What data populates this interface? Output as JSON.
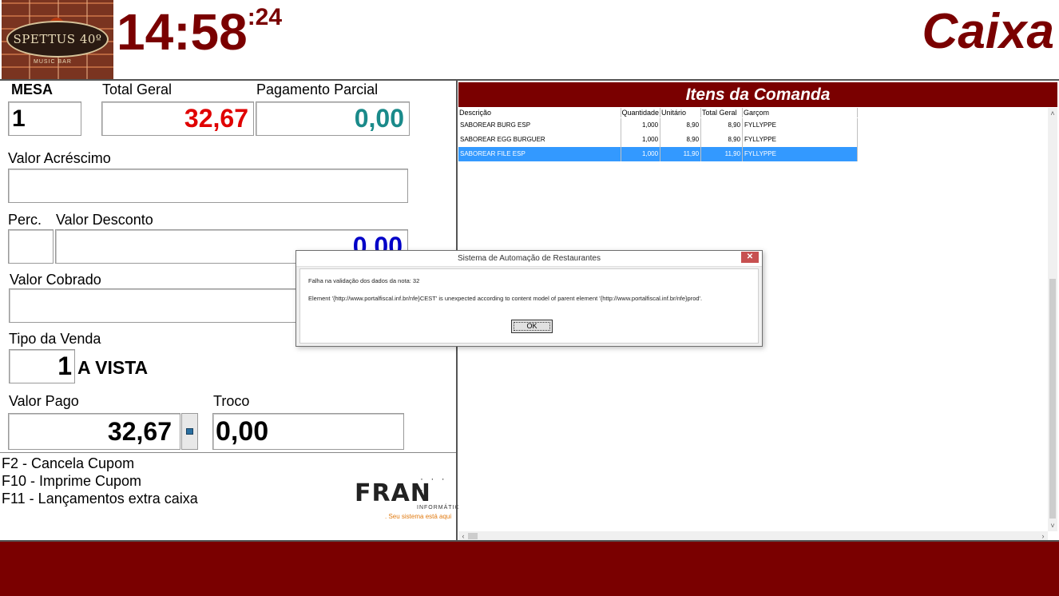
{
  "header": {
    "logo_text": "SPETTUS 40º",
    "logo_sub": "MUSIC BAR",
    "clock_hm": "14:58",
    "clock_sec": ":24",
    "screen_title": "Caixa"
  },
  "form": {
    "mesa_label": "MESA",
    "mesa_value": "1",
    "total_geral_label": "Total Geral",
    "total_geral_value": "32,67",
    "pagamento_parcial_label": "Pagamento Parcial",
    "pagamento_parcial_value": "0,00",
    "valor_acrescimo_label": "Valor Acréscimo",
    "valor_acrescimo_value": "",
    "perc_label": "Perc.",
    "perc_value": "",
    "valor_desconto_label": "Valor Desconto",
    "valor_desconto_value": "0,00",
    "valor_cobrado_label": "Valor Cobrado",
    "valor_cobrado_value": "",
    "tipo_venda_label": "Tipo da Venda",
    "tipo_venda_code": "1",
    "tipo_venda_desc": "A VISTA",
    "valor_pago_label": "Valor Pago",
    "valor_pago_value": "32,67",
    "troco_label": "Troco",
    "troco_value": "0,00"
  },
  "shortcuts": [
    "F2 - Cancela Cupom",
    "F10 - Imprime Cupom",
    "F11 - Lançamentos extra caixa"
  ],
  "fran_logo": {
    "word": "FRAN",
    "sub": "INFORMÁTICA",
    "slogan": ". Seu sistema está aqui"
  },
  "items": {
    "title": "Itens da Comanda",
    "columns": [
      "Descrição",
      "Quantidade",
      "Unitário",
      "Total Geral",
      "Garçom"
    ],
    "rows": [
      {
        "descricao": "SABOREAR BURG ESP",
        "quantidade": "1,000",
        "unitario": "8,90",
        "total": "8,90",
        "garcom": "FYLLYPPE"
      },
      {
        "descricao": "SABOREAR EGG BURGUER",
        "quantidade": "1,000",
        "unitario": "8,90",
        "total": "8,90",
        "garcom": "FYLLYPPE"
      },
      {
        "descricao": "SABOREAR FILE ESP",
        "quantidade": "1,000",
        "unitario": "11,90",
        "total": "11,90",
        "garcom": "FYLLYPPE"
      }
    ],
    "selected_row": 2
  },
  "dialog": {
    "title": "Sistema de Automação de Restaurantes",
    "message_1": "Falha na validação dos dados da nota: 32",
    "message_2": "Element '{http://www.portalfiscal.inf.br/nfe}CEST' is unexpected according to content model of parent element '{http://www.portalfiscal.inf.br/nfe}prod'.",
    "ok_label": "OK",
    "close_label": "✕"
  },
  "colors": {
    "brand": "#7a0000",
    "total_red": "#e00000",
    "parcial_teal": "#1a8a8a",
    "desconto_blue": "#0000c8",
    "selection": "#3399ff"
  }
}
